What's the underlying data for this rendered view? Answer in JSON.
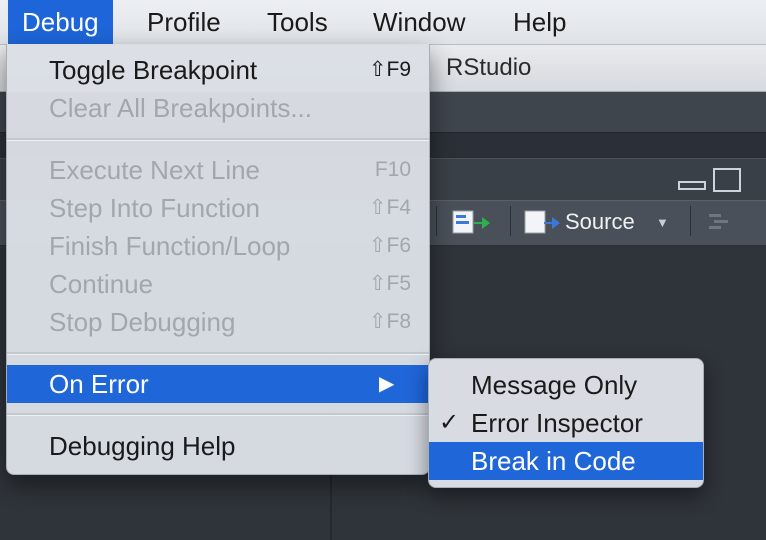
{
  "menubar": {
    "items": [
      "Debug",
      "Profile",
      "Tools",
      "Window",
      "Help"
    ],
    "active": "Debug"
  },
  "window": {
    "title": "RStudio"
  },
  "source_pane": {
    "toolbar": {
      "source_label": "Source"
    }
  },
  "debug_menu": {
    "toggle_breakpoint": {
      "label": "Toggle Breakpoint",
      "shortcut": "⇧F9",
      "enabled": true
    },
    "clear_all_breakpoints": {
      "label": "Clear All Breakpoints...",
      "enabled": false
    },
    "execute_next_line": {
      "label": "Execute Next Line",
      "shortcut": "F10",
      "enabled": false
    },
    "step_into_function": {
      "label": "Step Into Function",
      "shortcut": "⇧F4",
      "enabled": false
    },
    "finish_function_loop": {
      "label": "Finish Function/Loop",
      "shortcut": "⇧F6",
      "enabled": false
    },
    "continue": {
      "label": "Continue",
      "shortcut": "⇧F5",
      "enabled": false
    },
    "stop_debugging": {
      "label": "Stop Debugging",
      "shortcut": "⇧F8",
      "enabled": false
    },
    "on_error": {
      "label": "On Error",
      "submenu_arrow": "▶",
      "highlighted": true
    },
    "debugging_help": {
      "label": "Debugging Help",
      "enabled": true
    }
  },
  "on_error_submenu": {
    "items": [
      {
        "label": "Message Only",
        "checked": false
      },
      {
        "label": "Error Inspector",
        "checked": true,
        "check_mark": "✓"
      },
      {
        "label": "Break in Code",
        "highlighted": true
      }
    ]
  },
  "colors": {
    "highlight": "#1f66d9",
    "menu_bg": "#dbdfe5",
    "ide_dark": "#2f343a"
  }
}
